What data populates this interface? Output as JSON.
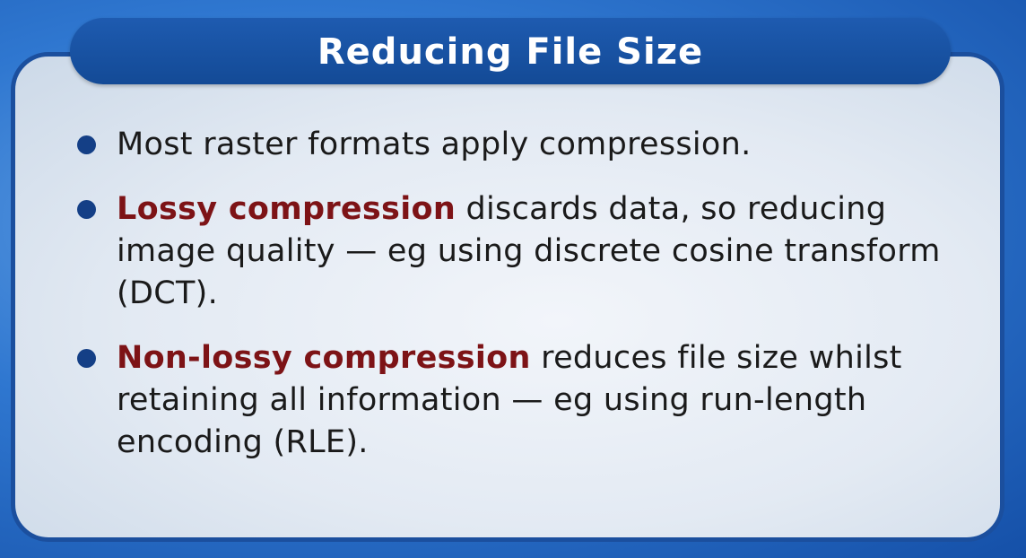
{
  "slide": {
    "title": "Reducing File Size",
    "bullets": [
      {
        "highlight": "",
        "text": "Most raster formats apply compression."
      },
      {
        "highlight": "Lossy compression",
        "text": " discards data, so reducing image quality — eg using discrete cosine transform (DCT)."
      },
      {
        "highlight": "Non-lossy compression",
        "text": " reduces file size whilst retaining all information — eg using run-length encoding (RLE)."
      }
    ]
  },
  "colors": {
    "title_bar": "#1a55a5",
    "frame_border": "#1b4f9e",
    "highlight_text": "#7d1316",
    "bullet_dot": "#143f86"
  }
}
